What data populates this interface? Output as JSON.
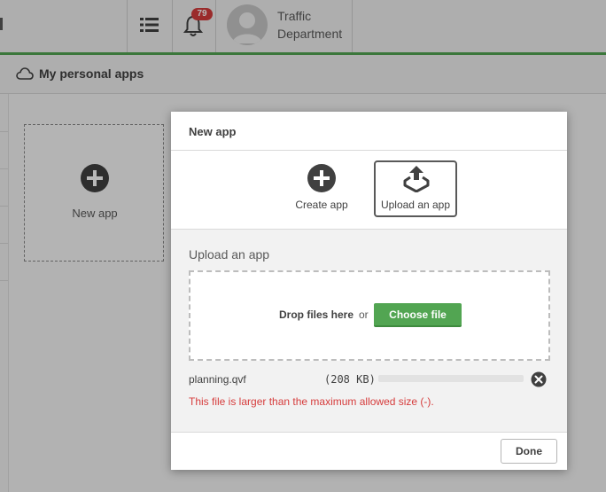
{
  "header": {
    "notification_count": "79",
    "user_name_line1": "Traffic",
    "user_name_line2": "Department",
    "accent_color": "#52a552",
    "icons": [
      "hub-list-icon",
      "bell-icon",
      "avatar-icon"
    ]
  },
  "subheader": {
    "title": "My personal apps",
    "icon": "cloud-icon"
  },
  "tile": {
    "label": "New app",
    "icon": "plus-circle-icon"
  },
  "modal": {
    "title": "New app",
    "options": [
      {
        "label": "Create app",
        "icon": "plus-circle-icon",
        "selected": false
      },
      {
        "label": "Upload an app",
        "icon": "upload-icon",
        "selected": true
      }
    ],
    "upload": {
      "heading": "Upload an app",
      "drop_text": "Drop files here",
      "or_text": "or",
      "choose_label": "Choose file"
    },
    "file": {
      "name": "planning.qvf",
      "size": "(208 KB)",
      "progress_percent": 0,
      "error": "This file is larger than the maximum allowed size (-).",
      "error_color": "#d63c3c"
    },
    "done_label": "Done"
  }
}
